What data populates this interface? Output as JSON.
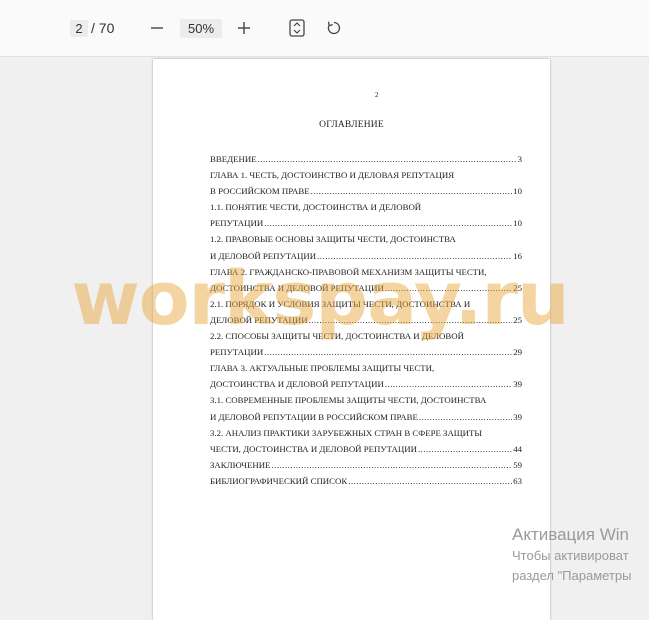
{
  "toolbar": {
    "page_current": "2",
    "page_total": "/ 70",
    "zoom_value": "50%",
    "zoom_out_icon": "minus-icon",
    "zoom_in_icon": "plus-icon",
    "fit_icon": "fit-to-page-icon",
    "rotate_icon": "rotate-icon"
  },
  "document": {
    "page_number": "2",
    "title": "ОГЛАВЛЕНИЕ",
    "toc": [
      {
        "text": "ВВЕДЕНИЕ",
        "page": "3"
      },
      {
        "text": "ГЛАВА 1. ЧЕСТЬ, ДОСТОИНСТВО И ДЕЛОВАЯ РЕПУТАЦИЯ",
        "page": ""
      },
      {
        "text": "В РОССИЙСКОМ ПРАВЕ",
        "page": "10"
      },
      {
        "text": "1.1. ПОНЯТИЕ ЧЕСТИ, ДОСТОИНСТВА И ДЕЛОВОЙ",
        "page": ""
      },
      {
        "text": "РЕПУТАЦИИ",
        "page": "10"
      },
      {
        "text": "1.2. ПРАВОВЫЕ ОСНОВЫ ЗАЩИТЫ ЧЕСТИ, ДОСТОИНСТВА",
        "page": ""
      },
      {
        "text": "И ДЕЛОВОЙ РЕПУТАЦИИ",
        "page": "16"
      },
      {
        "text": "ГЛАВА 2. ГРАЖДАНСКО-ПРАВОВОЙ МЕХАНИЗМ ЗАЩИТЫ ЧЕСТИ,",
        "page": ""
      },
      {
        "text": "ДОСТОИНСТВА И ДЕЛОВОЙ РЕПУТАЦИИ",
        "page": "25"
      },
      {
        "text": "2.1. ПОРЯДОК И УСЛОВИЯ ЗАЩИТЫ ЧЕСТИ, ДОСТОИНСТВА И",
        "page": ""
      },
      {
        "text": "ДЕЛОВОЙ РЕПУТАЦИИ",
        "page": "25"
      },
      {
        "text": "2.2. СПОСОБЫ ЗАЩИТЫ ЧЕСТИ, ДОСТОИНСТВА И ДЕЛОВОЙ",
        "page": ""
      },
      {
        "text": "РЕПУТАЦИИ",
        "page": "29"
      },
      {
        "text": "ГЛАВА 3. АКТУАЛЬНЫЕ ПРОБЛЕМЫ ЗАЩИТЫ ЧЕСТИ,",
        "page": ""
      },
      {
        "text": "ДОСТОИНСТВА И ДЕЛОВОЙ РЕПУТАЦИИ",
        "page": "39"
      },
      {
        "text": "3.1. СОВРЕМЕННЫЕ ПРОБЛЕМЫ ЗАЩИТЫ ЧЕСТИ, ДОСТОИНСТВА",
        "page": ""
      },
      {
        "text": "И ДЕЛОВОЙ РЕПУТАЦИИ В РОССИЙСКОМ ПРАВЕ",
        "page": "39"
      },
      {
        "text": "3.2. АНАЛИЗ ПРАКТИКИ ЗАРУБЕЖНЫХ СТРАН В СФЕРЕ ЗАЩИТЫ",
        "page": ""
      },
      {
        "text": "ЧЕСТИ, ДОСТОИНСТВА И ДЕЛОВОЙ РЕПУТАЦИИ",
        "page": "44"
      },
      {
        "text": "ЗАКЛЮЧЕНИЕ",
        "page": "59"
      },
      {
        "text": "БИБЛИОГРАФИЧЕСКИЙ СПИСОК",
        "page": "63"
      }
    ]
  },
  "watermark": "workspay.ru",
  "activation": {
    "title": "Активация Win",
    "line1": "Чтобы активироват",
    "line2": "раздел \"Параметры"
  },
  "colors": {
    "watermark": "#e8a83c",
    "toolbar_bg": "#fafafa",
    "viewer_bg": "#f0f0f0"
  }
}
